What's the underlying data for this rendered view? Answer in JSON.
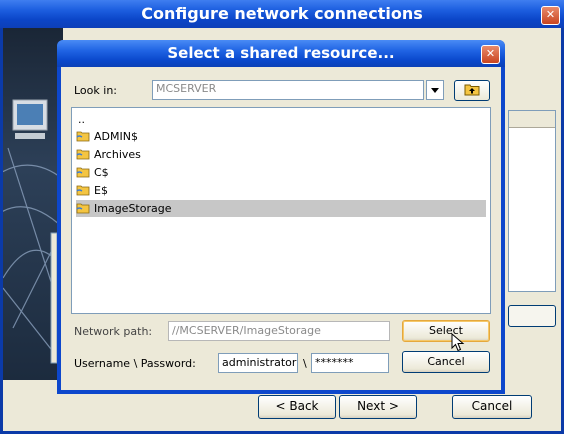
{
  "outer_window": {
    "title": "Configure network connections",
    "close_glyph": "✕",
    "buttons": {
      "back": "< Back",
      "next": "Next >",
      "cancel": "Cancel"
    }
  },
  "dialog": {
    "title": "Select a shared resource...",
    "close_glyph": "✕",
    "look_in_label": "Look in:",
    "look_in_value": "MCSERVER",
    "up_folder_icon": "up-folder-icon",
    "files": [
      {
        "name": "..",
        "icon": ""
      },
      {
        "name": "ADMIN$",
        "icon": "shared-folder-icon"
      },
      {
        "name": "Archives",
        "icon": "shared-folder-icon"
      },
      {
        "name": "C$",
        "icon": "shared-folder-icon"
      },
      {
        "name": "E$",
        "icon": "shared-folder-icon"
      },
      {
        "name": "ImageStorage",
        "icon": "shared-folder-icon",
        "selected": true
      }
    ],
    "network_path_label": "Network path:",
    "network_path_value": "//MCSERVER/ImageStorage",
    "credentials_label": "Username \\ Password:",
    "username_value": "administrator",
    "separator": "\\",
    "password_value": "*******",
    "select_button": "Select",
    "cancel_button": "Cancel"
  },
  "colors": {
    "title_bar": "#0b45c8",
    "dialog_face": "#ece9d8",
    "selection": "#c7c7c7",
    "folder": "#f4c542"
  }
}
